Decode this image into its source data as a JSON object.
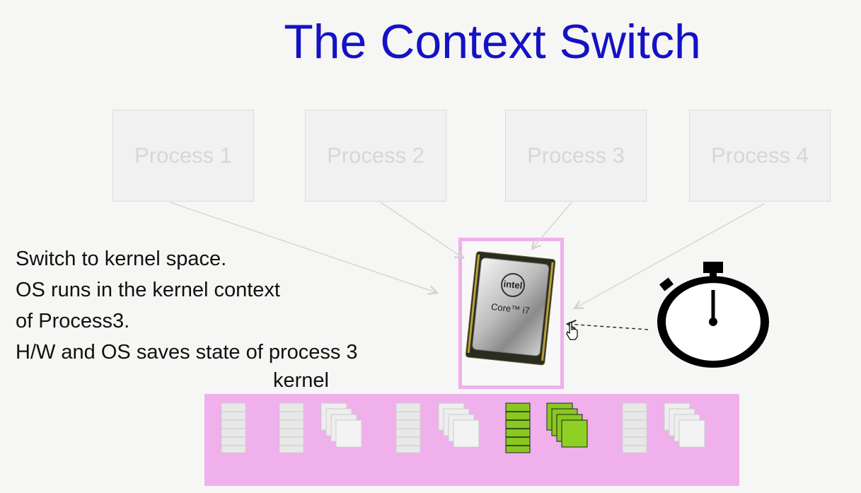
{
  "slide": {
    "title": "The Context Switch"
  },
  "processes": [
    {
      "label": "Process 1"
    },
    {
      "label": "Process 2"
    },
    {
      "label": "Process 3"
    },
    {
      "label": "Process 4"
    }
  ],
  "description": {
    "line1": "Switch to kernel space.",
    "line2": "OS runs in the kernel context",
    "line3": "of Process3.",
    "line4": "H/W and OS saves state of process 3"
  },
  "kernel": {
    "label": "kernel"
  },
  "cpu": {
    "brand": "intel",
    "model": "Core™ i7",
    "icon": "cpu-chip-icon"
  },
  "timer": {
    "icon": "stopwatch-icon"
  },
  "colors": {
    "title": "#1412c4",
    "kernel_region": "#efb0ec",
    "active_state": "#88c820",
    "inactive_state": "#e8e8e8"
  }
}
